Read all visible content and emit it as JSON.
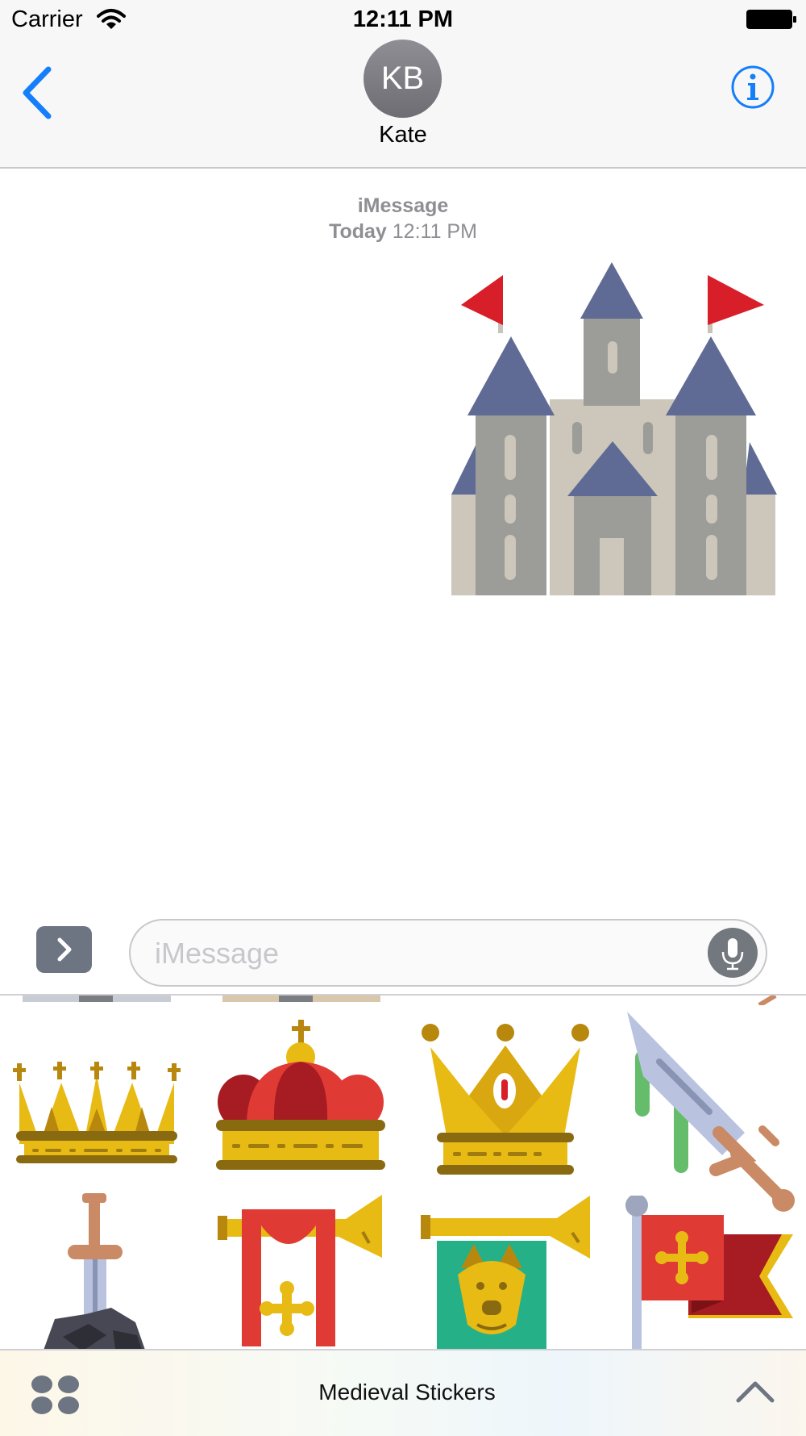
{
  "status_bar": {
    "carrier": "Carrier",
    "time": "12:11 PM"
  },
  "nav": {
    "avatar_initials": "KB",
    "contact_name": "Kate"
  },
  "conversation": {
    "service": "iMessage",
    "day": "Today",
    "time": "12:11 PM",
    "sent_sticker": "castle"
  },
  "input": {
    "placeholder": "iMessage"
  },
  "sticker_grid": {
    "stickers": [
      "crown-five-spikes",
      "red-royal-crown",
      "gold-crown-gem",
      "bloody-dagger",
      "sword-in-stone",
      "trumpet-red-banner",
      "trumpet-wolf-banner",
      "red-flag-cross"
    ]
  },
  "drawer": {
    "app_name": "Medieval Stickers"
  },
  "colors": {
    "accent": "#147efb",
    "gold": "#e8ba14",
    "red": "#e03a34",
    "slate": "#5f6b94",
    "stone": "#9c9c98"
  }
}
